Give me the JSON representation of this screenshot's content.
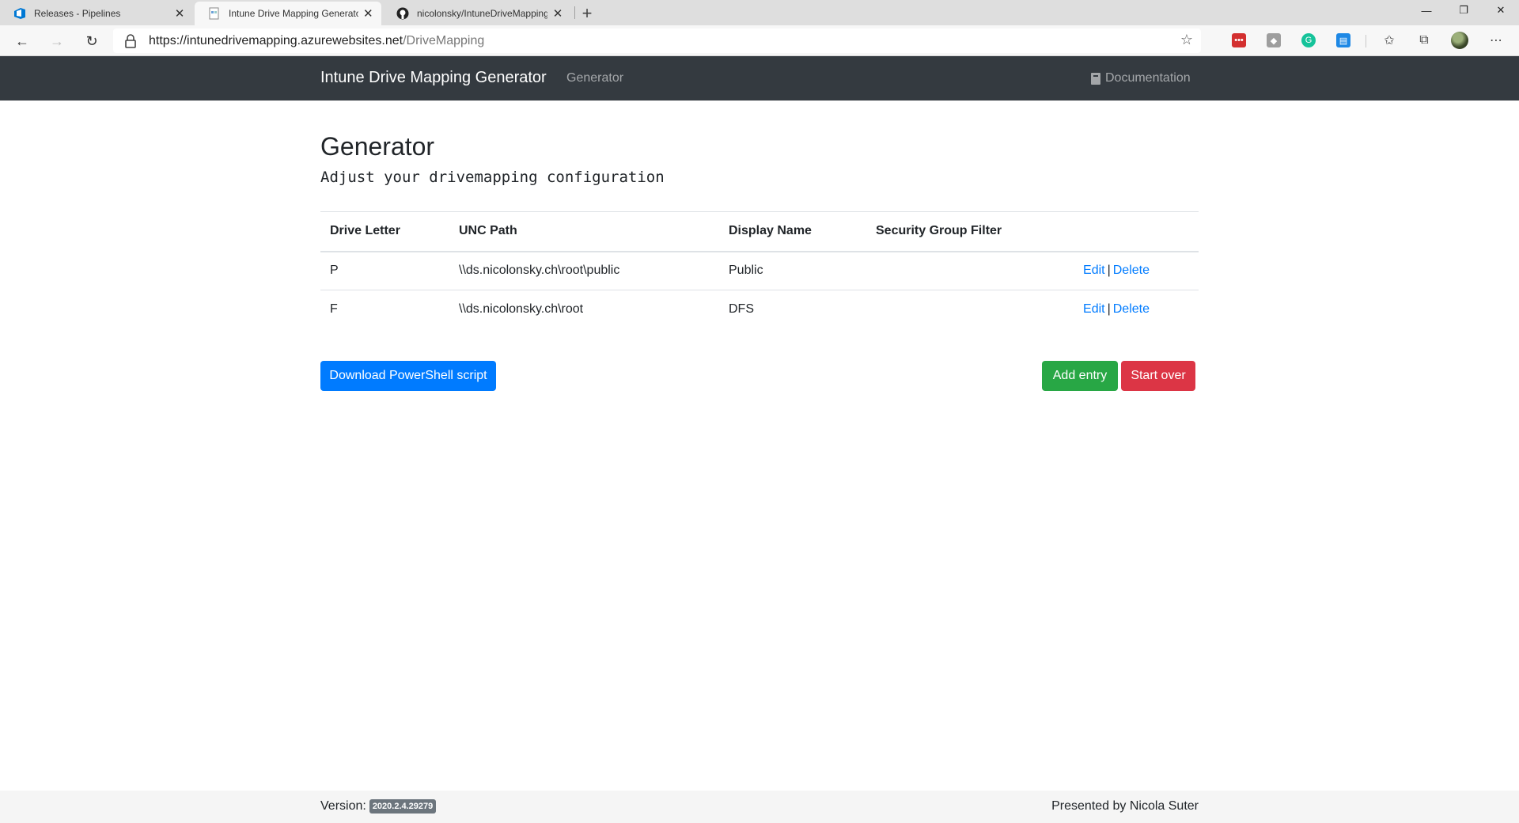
{
  "browser": {
    "tabs": [
      {
        "title": "Releases - Pipelines",
        "active": false,
        "icon": "azure-devops-icon"
      },
      {
        "title": "Intune Drive Mapping Generator",
        "active": true,
        "icon": "page-icon"
      },
      {
        "title": "nicolonsky/IntuneDriveMapping",
        "active": false,
        "icon": "github-icon"
      }
    ],
    "url_host": "https://intunedrivemapping.azurewebsites.net",
    "url_path": "/DriveMapping"
  },
  "navbar": {
    "brand": "Intune Drive Mapping Generator",
    "link": "Generator",
    "documentation": "Documentation"
  },
  "main": {
    "title": "Generator",
    "subtitle": "Adjust your drivemapping configuration",
    "table": {
      "headers": [
        "Drive Letter",
        "UNC Path",
        "Display Name",
        "Security Group Filter"
      ],
      "rows": [
        {
          "letter": "P",
          "unc": "\\\\ds.nicolonsky.ch\\root\\public",
          "display": "Public",
          "filter": ""
        },
        {
          "letter": "F",
          "unc": "\\\\ds.nicolonsky.ch\\root",
          "display": "DFS",
          "filter": ""
        }
      ],
      "edit_label": "Edit",
      "separator": "|",
      "delete_label": "Delete"
    },
    "buttons": {
      "download": "Download PowerShell script",
      "add": "Add entry",
      "start_over": "Start over"
    }
  },
  "footer": {
    "version_label": "Version:",
    "version": "2020.2.4.29279",
    "presented_by": "Presented by Nicola Suter"
  },
  "colors": {
    "navbar": "#343a40",
    "primary": "#007bff",
    "success": "#28a745",
    "danger": "#dc3545"
  }
}
